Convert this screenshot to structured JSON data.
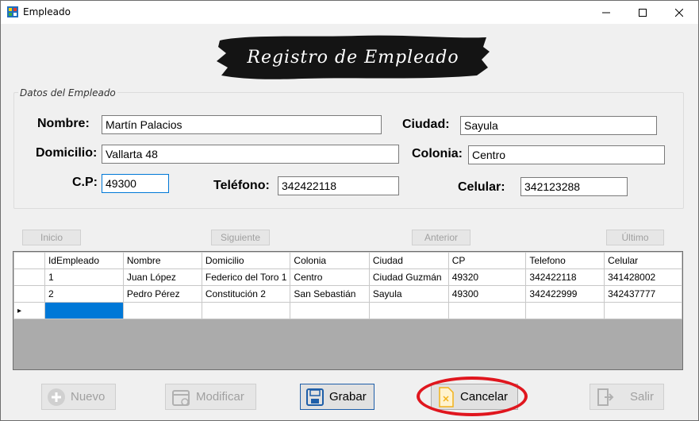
{
  "window": {
    "title": "Empleado",
    "controls": {
      "minimize": "minimize-icon",
      "maximize": "maximize-icon",
      "close": "close-icon"
    }
  },
  "banner": {
    "text": "Registro de Empleado"
  },
  "group": {
    "title": "Datos del Empleado"
  },
  "form": {
    "nombre_label": "Nombre:",
    "nombre_value": "Martín Palacios",
    "ciudad_label": "Ciudad:",
    "ciudad_value": "Sayula",
    "domicilio_label": "Domicilio:",
    "domicilio_value": "Vallarta 48",
    "colonia_label": "Colonia:",
    "colonia_value": "Centro",
    "cp_label": "C.P:",
    "cp_value": "49300",
    "telefono_label": "Teléfono:",
    "telefono_value": "342422118",
    "celular_label": "Celular:",
    "celular_value": "342123288"
  },
  "nav": {
    "inicio": "Inicio",
    "siguiente": "Siguiente",
    "anterior": "Anterior",
    "ultimo": "Último"
  },
  "table": {
    "columns": [
      "IdEmpleado",
      "Nombre",
      "Domicilio",
      "Colonia",
      "Ciudad",
      "CP",
      "Telefono",
      "Celular"
    ],
    "rows": [
      [
        "1",
        "Juan López",
        "Federico del Toro 1",
        "Centro",
        "Ciudad Guzmán",
        "49320",
        "342422118",
        "341428002"
      ],
      [
        "2",
        "Pedro Pérez",
        "Constitución 2",
        "San Sebastián",
        "Sayula",
        "49300",
        "342422999",
        "342437777"
      ]
    ],
    "new_row_marker": "▸"
  },
  "actions": {
    "nuevo": "Nuevo",
    "modificar": "Modificar",
    "grabar": "Grabar",
    "cancelar": "Cancelar",
    "salir": "Salir"
  },
  "colors": {
    "accent": "#0078d7",
    "highlight_ring": "#e0161e",
    "grid_background": "#ababab"
  }
}
